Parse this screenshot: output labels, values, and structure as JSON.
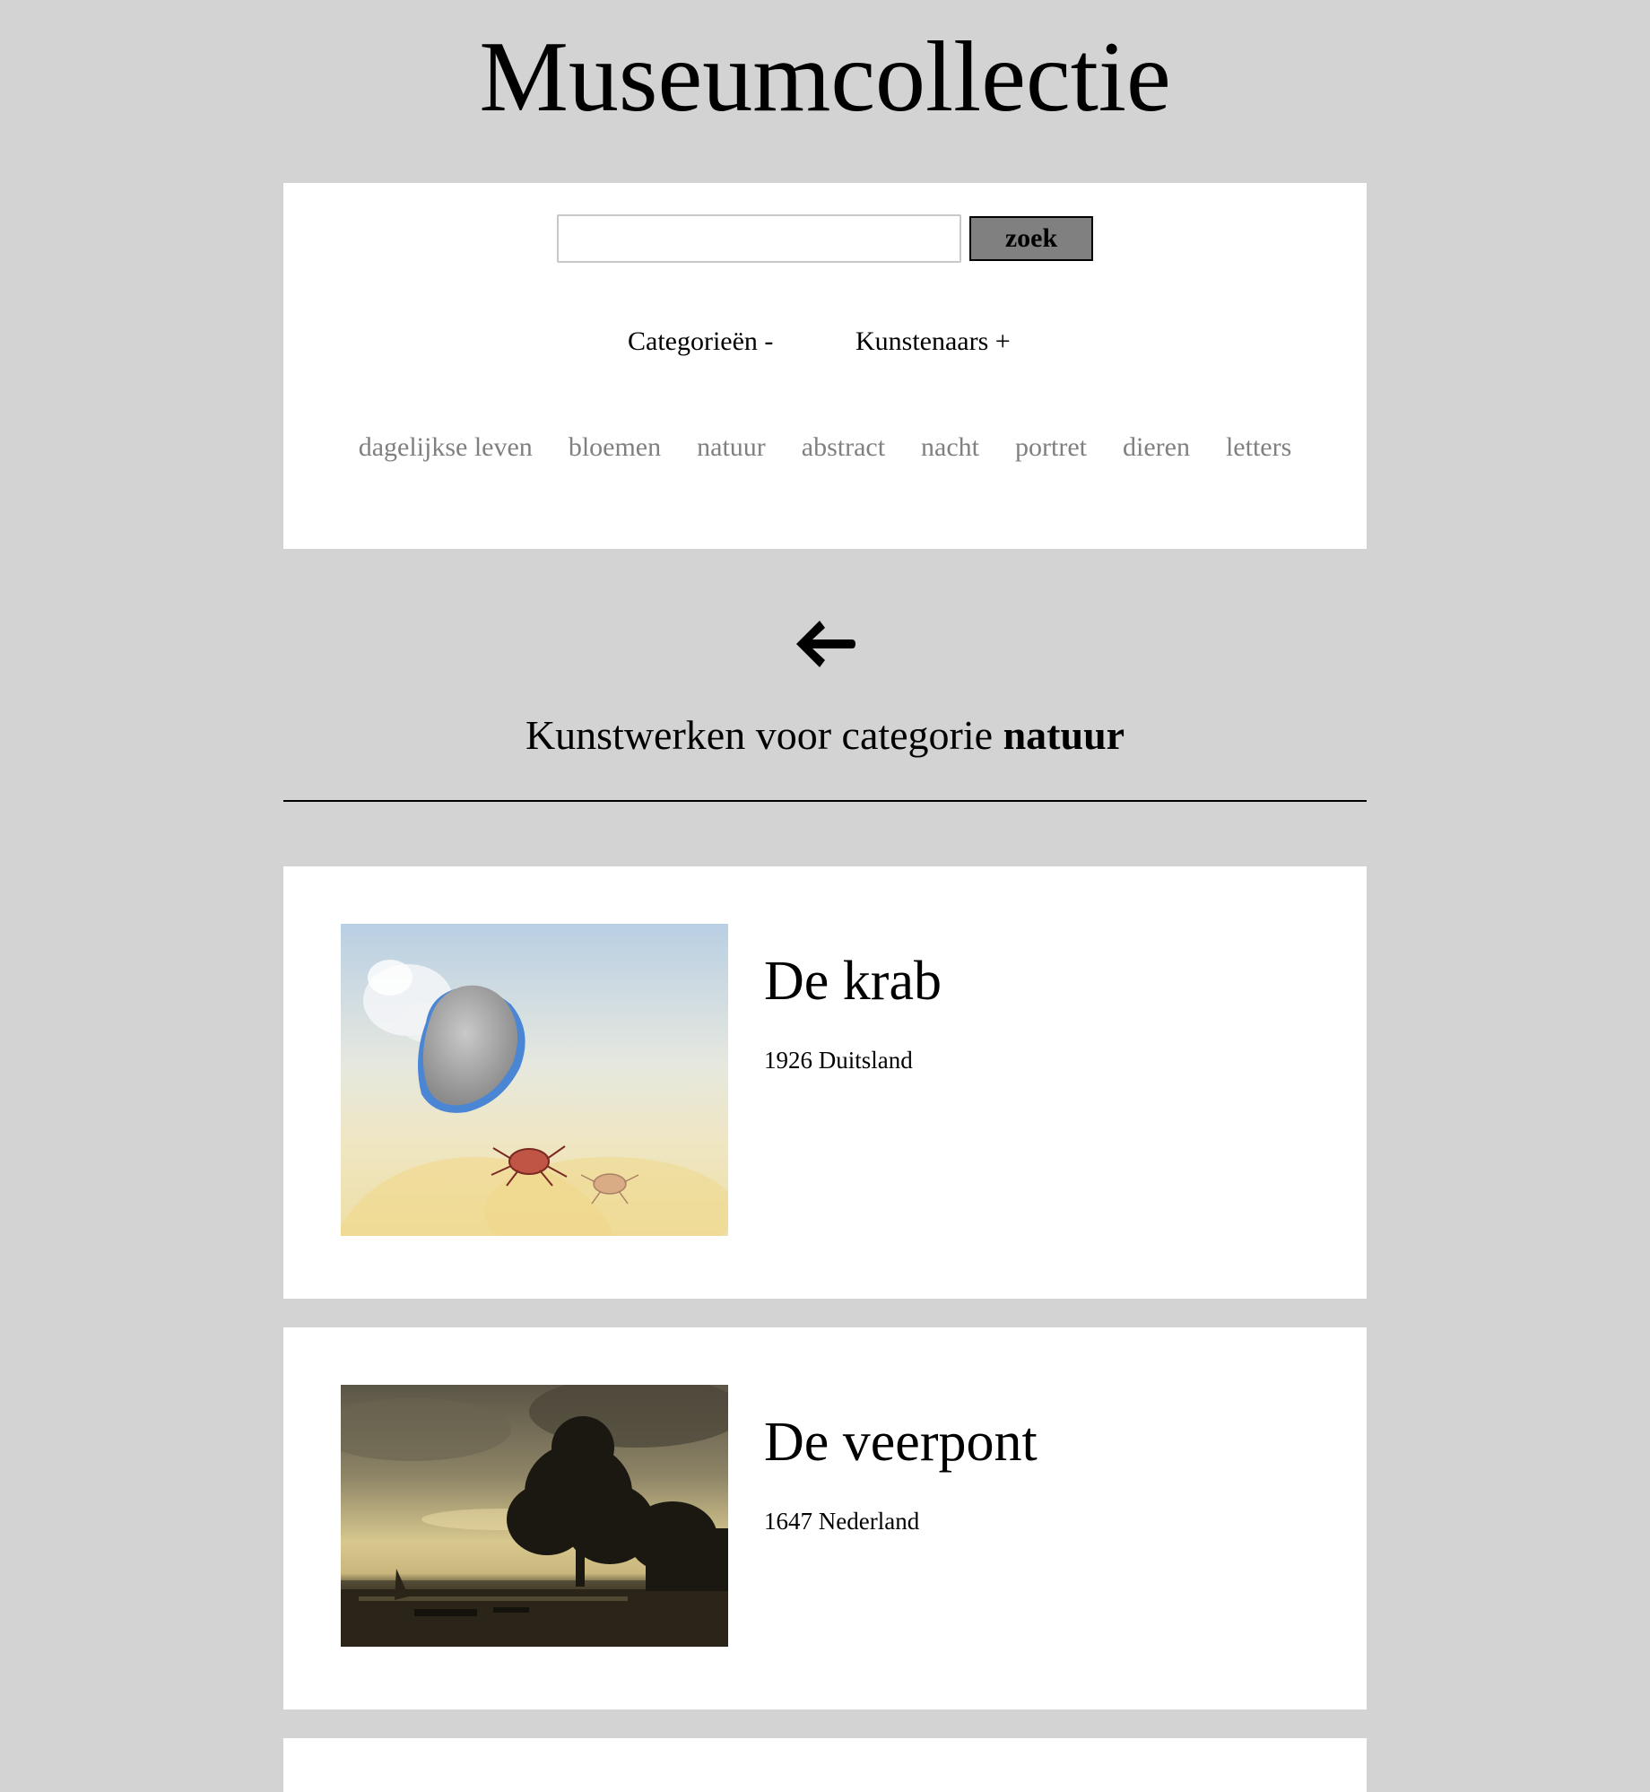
{
  "site": {
    "title": "Museumcollectie"
  },
  "search": {
    "value": "",
    "placeholder": "",
    "button_label": "zoek"
  },
  "filters": {
    "categories_toggle": "Categorieën -",
    "artists_toggle": "Kunstenaars +",
    "categories": [
      "dagelijkse leven",
      "bloemen",
      "natuur",
      "abstract",
      "nacht",
      "portret",
      "dieren",
      "letters"
    ]
  },
  "nav": {
    "back_icon": "arrow-left-icon"
  },
  "results": {
    "heading_prefix": "Kunstwerken voor categorie",
    "heading_category": "natuur",
    "artworks": [
      {
        "title": "De krab",
        "year": "1926",
        "country": "Duitsland",
        "image_icon": "surreal-crab-painting"
      },
      {
        "title": "De veerpont",
        "year": "1647",
        "country": "Nederland",
        "image_icon": "river-landscape-painting"
      }
    ]
  }
}
